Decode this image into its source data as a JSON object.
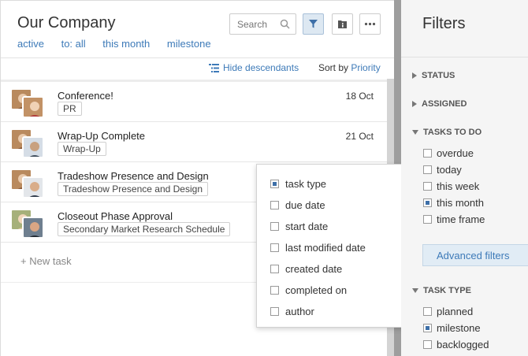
{
  "header": {
    "title": "Our Company",
    "scopes": [
      "active",
      "to: all",
      "this month",
      "milestone"
    ],
    "search_placeholder": "Search"
  },
  "subbar": {
    "hide_descendants": "Hide descendants",
    "sort_prefix": "Sort by",
    "sort_value": "Priority"
  },
  "tasks": [
    {
      "title": "Conference!",
      "tag": "PR",
      "date": "18 Oct"
    },
    {
      "title": "Wrap-Up Complete",
      "tag": "Wrap-Up",
      "date": "21 Oct"
    },
    {
      "title": "Tradeshow Presence and Design",
      "tag": "Tradeshow Presence and Design",
      "date": ""
    },
    {
      "title": "Closeout Phase Approval",
      "tag": "Secondary Market Research Schedule",
      "date": ""
    }
  ],
  "new_task_label": "New task",
  "dropdown": {
    "options": [
      {
        "label": "task type",
        "checked": true
      },
      {
        "label": "due date",
        "checked": false
      },
      {
        "label": "start date",
        "checked": false
      },
      {
        "label": "last modified date",
        "checked": false
      },
      {
        "label": "created date",
        "checked": false
      },
      {
        "label": "completed on",
        "checked": false
      },
      {
        "label": "author",
        "checked": false
      }
    ]
  },
  "filters": {
    "title": "Filters",
    "status_label": "STATUS",
    "assigned_label": "ASSIGNED",
    "tasks_to_do": {
      "label": "TASKS TO DO",
      "items": [
        {
          "label": "overdue",
          "checked": false
        },
        {
          "label": "today",
          "checked": false
        },
        {
          "label": "this week",
          "checked": false
        },
        {
          "label": "this month",
          "checked": true
        },
        {
          "label": "time frame",
          "checked": false
        }
      ]
    },
    "advanced_label": "Advanced filters",
    "task_type": {
      "label": "TASK TYPE",
      "items": [
        {
          "label": "planned",
          "checked": false
        },
        {
          "label": "milestone",
          "checked": true
        },
        {
          "label": "backlogged",
          "checked": false
        }
      ]
    }
  },
  "colors": {
    "accent": "#3d7ab8",
    "checked_fill": "#3d6fa8",
    "gutter": "#9e9e9e"
  }
}
